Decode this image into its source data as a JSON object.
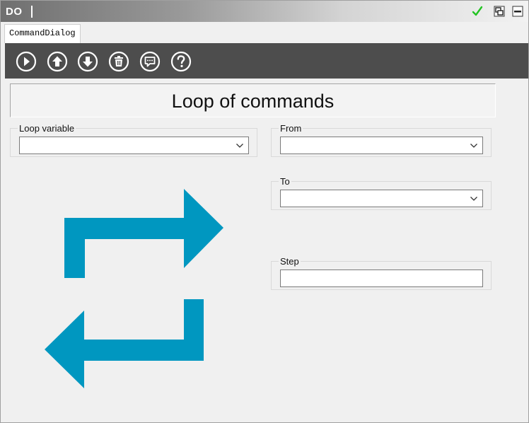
{
  "window": {
    "title": "DO",
    "controls": [
      "check-icon",
      "restore-icon",
      "minimize-icon"
    ],
    "check_color": "#22c422"
  },
  "tabs": [
    {
      "label": "CommandDialog",
      "active": true
    }
  ],
  "toolbar": {
    "background": "#4d4d4d",
    "buttons": [
      "run-icon",
      "move-up-icon",
      "move-down-icon",
      "delete-icon",
      "comment-icon",
      "help-icon"
    ]
  },
  "header": {
    "title": "Loop of commands"
  },
  "form": {
    "loop_variable": {
      "label": "Loop variable",
      "value": ""
    },
    "from": {
      "label": "From",
      "value": ""
    },
    "to": {
      "label": "To",
      "value": ""
    },
    "step": {
      "label": "Step",
      "value": ""
    }
  },
  "illustration": {
    "icon": "loop-arrows-icon",
    "color": "#0097c0"
  }
}
